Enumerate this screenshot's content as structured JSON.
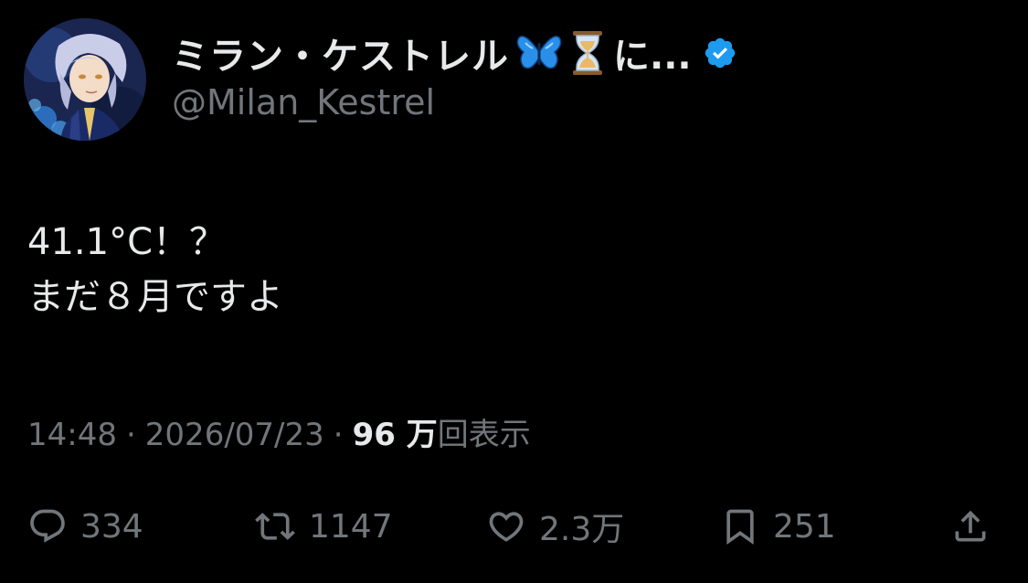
{
  "colors": {
    "background": "#000000",
    "primary_text": "#e7e9ea",
    "secondary_text": "#71767b",
    "verified_blue": "#1d9bf0"
  },
  "author": {
    "display_name": "ミラン・ケストレル",
    "name_emojis": [
      "butterfly-emoji",
      "hourglass-emoji"
    ],
    "name_suffix": "に...",
    "verified": true,
    "handle": "@Milan_Kestrel"
  },
  "post": {
    "lines": [
      "41.1°C！？",
      "まだ８月ですよ"
    ]
  },
  "meta": {
    "time": "14:48",
    "separator": "·",
    "date": "2026/07/23",
    "views_count": "96 万",
    "views_label": "回表示"
  },
  "actions": {
    "reply": {
      "icon": "reply-icon",
      "count": "334"
    },
    "retweet": {
      "icon": "retweet-icon",
      "count": "1147"
    },
    "like": {
      "icon": "heart-icon",
      "count": "2.3万"
    },
    "bookmark": {
      "icon": "bookmark-icon",
      "count": "251"
    },
    "share": {
      "icon": "share-icon"
    }
  }
}
